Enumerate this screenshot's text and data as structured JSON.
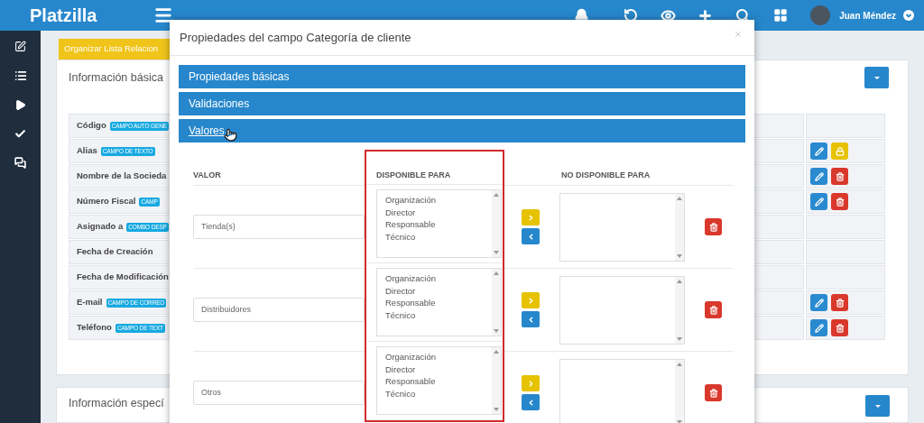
{
  "header": {
    "logo": "Platzilla",
    "user": {
      "name": "Juan Méndez"
    }
  },
  "page": {
    "organize_button": "Organizar Lista Relacion",
    "card": {
      "title": "Información básica",
      "rows": [
        {
          "label": "Código",
          "badge": "CAMPO AUTO GENE",
          "actions": []
        },
        {
          "label": "Alias",
          "badge": "CAMPO DE TEXTO",
          "actions": [
            {
              "kind": "edit"
            },
            {
              "kind": "lock"
            }
          ]
        },
        {
          "label": "Nombre de la Socieda",
          "actions": [
            {
              "kind": "edit"
            },
            {
              "kind": "delete"
            }
          ]
        },
        {
          "label": "Número Fiscal",
          "badge": "CAMP",
          "actions": [
            {
              "kind": "edit"
            },
            {
              "kind": "delete"
            }
          ]
        },
        {
          "label": "Asignado a",
          "badge": "COMBO DESP",
          "actions": []
        },
        {
          "label": "Fecha de Creación",
          "actions": []
        },
        {
          "label": "Fecha de Modificación",
          "actions": []
        },
        {
          "label": "E-mail",
          "badge": "CAMPO DE CORREO",
          "actions": [
            {
              "kind": "edit"
            },
            {
              "kind": "delete"
            }
          ]
        },
        {
          "label": "Teléfono",
          "badge": "CAMPO DE TEXT",
          "actions": [
            {
              "kind": "edit"
            },
            {
              "kind": "delete"
            }
          ]
        }
      ]
    },
    "card2": {
      "title": "Información especí"
    }
  },
  "modal": {
    "title": "Propiedades del campo Categoría de cliente",
    "sections": [
      {
        "label": "Propiedades básicas",
        "expanded": false
      },
      {
        "label": "Validaciones",
        "expanded": false
      },
      {
        "label": "Valores",
        "expanded": true
      }
    ],
    "columns": [
      "VALOR",
      "DISPONIBLE PARA",
      "NO DISPONIBLE PARA"
    ],
    "rows": [
      {
        "value": "Tienda(s)",
        "available": [
          "Organización",
          "Director",
          "Responsable",
          "Técnico"
        ]
      },
      {
        "value": "Distribuidores",
        "available": [
          "Organización",
          "Director",
          "Responsable",
          "Técnico"
        ]
      },
      {
        "value": "Otros",
        "available": [
          "Organización",
          "Director",
          "Responsable",
          "Técnico"
        ]
      }
    ]
  }
}
